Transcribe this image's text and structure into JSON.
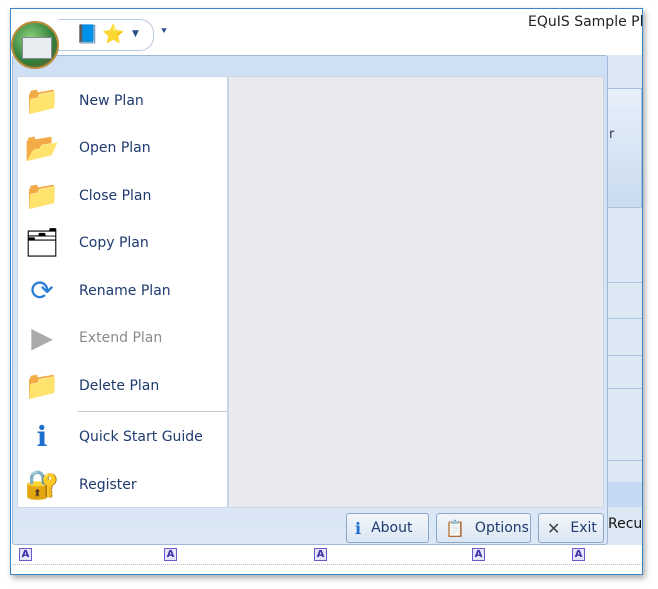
{
  "window": {
    "title": "EQuIS Sample Planning"
  },
  "quick_access": [
    {
      "icon": "book-icon",
      "label": ""
    },
    {
      "icon": "star-icon",
      "label": ""
    }
  ],
  "menu": {
    "items": [
      {
        "label": "New Plan",
        "icon": "new-folder-icon",
        "enabled": true
      },
      {
        "label": "Open Plan",
        "icon": "open-folder-icon",
        "enabled": true
      },
      {
        "label": "Close Plan",
        "icon": "close-folder-icon",
        "enabled": true
      },
      {
        "label": "Copy Plan",
        "icon": "copy-folder-icon",
        "enabled": true
      },
      {
        "label": "Rename Plan",
        "icon": "rename-icon",
        "enabled": true
      },
      {
        "label": "Extend Plan",
        "icon": "extend-icon",
        "enabled": false
      },
      {
        "label": "Delete Plan",
        "icon": "delete-folder-icon",
        "enabled": true
      },
      {
        "label": "Quick Start Guide",
        "icon": "info-icon",
        "enabled": true
      },
      {
        "label": "Register",
        "icon": "lock-key-icon",
        "enabled": true
      }
    ],
    "footer": {
      "about": "About",
      "options": "Options",
      "exit": "Exit"
    }
  },
  "background": {
    "recur_text": "Recur",
    "ribbon_partial": "r"
  }
}
